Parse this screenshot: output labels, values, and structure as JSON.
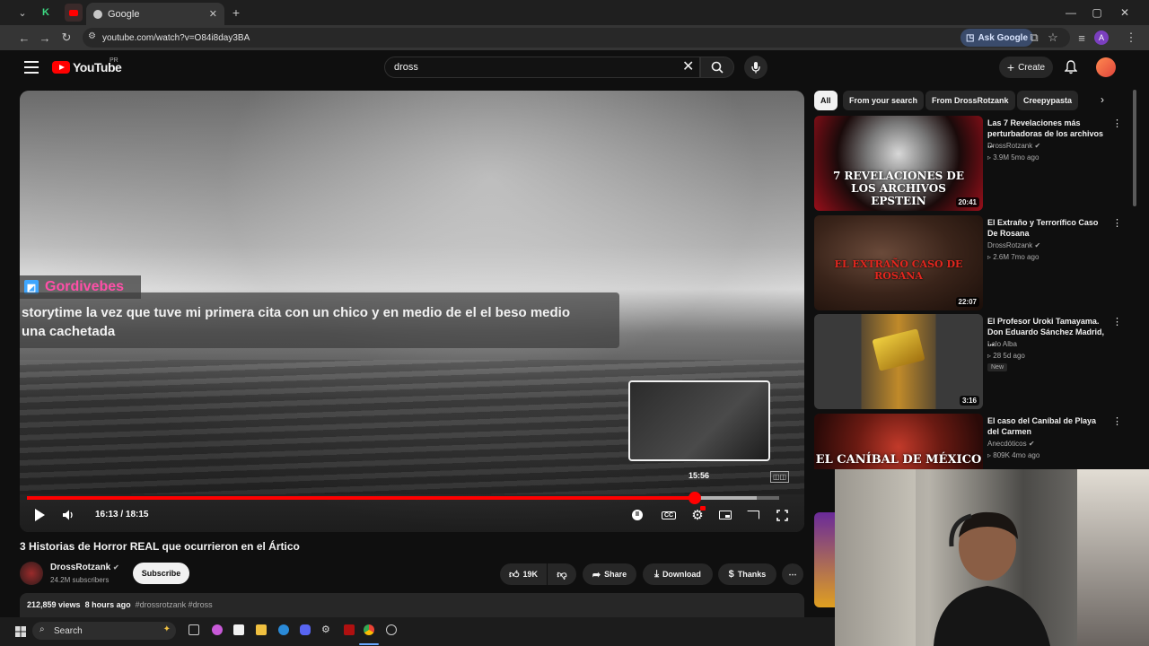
{
  "browser": {
    "tab_title": "Google",
    "url": "youtube.com/watch?v=O84i8day3BA",
    "ask_google": "Ask Google",
    "profile_initial": "A"
  },
  "header": {
    "logo_text": "YouTube",
    "country_code": "PR",
    "search_query": "dross",
    "create_label": "Create"
  },
  "player": {
    "overlay_username": "Gordivebes",
    "overlay_message": "storytime la vez que tuve mi primera cita con un chico y en medio de el el beso medio una cachetada",
    "preview_time": "15:56",
    "time_display": "16:13 / 18:15",
    "progress_played_fraction": 0.888,
    "progress_buffered_fraction": 0.97,
    "hover_fraction": 0.875
  },
  "video": {
    "title": "3 Historias de Horror REAL que ocurrieron en el Ártico",
    "channel": "DrossRotzank",
    "subscribers": "24.2M subscribers",
    "subscribe_label": "Subscribe",
    "likes": "19K",
    "share_label": "Share",
    "download_label": "Download",
    "thanks_label": "Thanks",
    "views": "212,859 views",
    "posted": "8 hours ago",
    "hashtags": "#drossrotzank #dross"
  },
  "sidebar": {
    "chips": [
      "All",
      "From your search",
      "From DrossRotzank",
      "Creepypasta"
    ],
    "recommendations": [
      {
        "title": "Las 7 Revelaciones más perturbadoras de los archivos ...",
        "channel": "DrossRotzank",
        "stats": "3.9M  5mo ago",
        "duration": "20:41",
        "thumb_text": "7 REVELACIONES DE LOS ARCHIVOS EPSTEIN"
      },
      {
        "title": "El Extraño y Terrorífico Caso De Rosana",
        "channel": "DrossRotzank",
        "stats": "2.6M  7mo ago",
        "duration": "22:07",
        "thumb_text": "EL EXTRAÑO CASO DE ROSANA"
      },
      {
        "title": "El Profesor Uroki Tamayama. Don Eduardo Sánchez Madrid, ...",
        "channel": "Lalo Alba",
        "stats": "28  5d ago",
        "badge": "New",
        "duration": "3:16"
      },
      {
        "title": "El caso del Caníbal de Playa del Carmen",
        "channel": "Anecdóticos",
        "stats": "809K  4mo ago",
        "thumb_text": "EL CANÍBAL DE MÉXICO"
      }
    ]
  },
  "taskbar": {
    "search_label": "Search"
  }
}
